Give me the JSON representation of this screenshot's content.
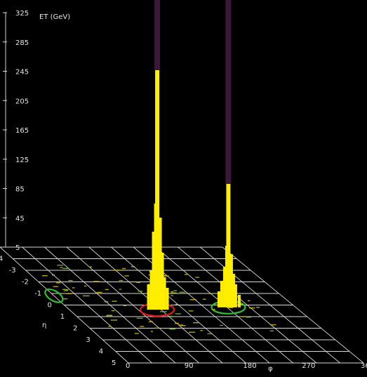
{
  "chart_data": {
    "type": "lego-plot",
    "et_axis": {
      "label": "ET (GeV)",
      "ticks": [
        5,
        45,
        85,
        125,
        165,
        205,
        245,
        285,
        325
      ],
      "range": [
        5,
        325
      ]
    },
    "phi_axis": {
      "label": "φ",
      "ticks": [
        0,
        90,
        180,
        270,
        360
      ],
      "range": [
        0,
        360
      ]
    },
    "eta_axis": {
      "label": "η",
      "ticks": [
        -4,
        -3,
        -2,
        -1,
        0,
        1,
        2,
        3,
        4,
        5
      ],
      "range": [
        -5,
        5
      ]
    },
    "towers": [
      {
        "name": "jet-1-core",
        "phi": 138,
        "eta": 0.4,
        "et": 2000,
        "color": "#ffee00"
      },
      {
        "name": "jet-2-core",
        "phi": 254,
        "eta": 0.2,
        "et": 2000,
        "color": "#ffee00"
      }
    ],
    "jet_circles": [
      {
        "phi": 138,
        "eta": 0.4,
        "color": "#e01818"
      },
      {
        "phi": 254,
        "eta": 0.2,
        "color": "#2ec02e"
      },
      {
        "phi": 0,
        "eta": -0.8,
        "color": "#2ec02e"
      }
    ],
    "colors": {
      "background": "#000000",
      "grid": "#d9d9d9",
      "tower": "#ffee00",
      "tower_top": "#3a1838"
    }
  }
}
